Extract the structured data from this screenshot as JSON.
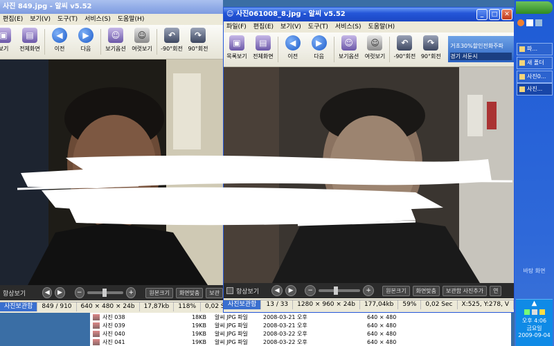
{
  "left_window": {
    "title": "사진 849.jpg - 알씨 v5.52",
    "menu": [
      "편집(E)",
      "보기(V)",
      "도구(T)",
      "서비스(S)",
      "도움말(H)"
    ],
    "tools": [
      "보기",
      "전체화면",
      "이전",
      "다음",
      "보기옵션",
      "여럿보기",
      "-90°회전",
      "90°회전"
    ],
    "bottom": {
      "always_view": "항상보기",
      "original_size": "원본크기",
      "fit_screen": "화면맞춤",
      "clip": "보관"
    },
    "status": {
      "tab": "사진보관함",
      "index": "849 / 910",
      "dims": "640 × 480 × 24b",
      "size": "17,87kb",
      "zoom": "118%",
      "time": "0,02 Sec"
    }
  },
  "right_window": {
    "title": "사진061008_8.jpg - 알씨 v5.52",
    "menu": [
      "파일(F)",
      "편집(E)",
      "보기(V)",
      "도구(T)",
      "서비스(S)",
      "도움말(H)"
    ],
    "tools": [
      "목록보기",
      "전체화면",
      "이전",
      "다음",
      "보기옵션",
      "여럿보기",
      "-90°회전",
      "90°회전"
    ],
    "ad_text": "거초30%할인전화주파",
    "ad_sub": "경기 서둔시",
    "bottom": {
      "always_view": "항상보기",
      "original_size": "원본크기",
      "fit_screen": "화면맞춤",
      "add_clip": "보관함 사진추가",
      "more": "연"
    },
    "status": {
      "tab": "사진보관함",
      "index": "13 / 33",
      "dims": "1280 × 960 × 24b",
      "size": "177,04kb",
      "zoom": "59%",
      "time": "0,02 Sec",
      "coords": "X:525, Y:278, V"
    }
  },
  "file_list": [
    {
      "name": "사진 038",
      "size": "18KB",
      "type": "알씨 JPG 파일",
      "date": "2008-03-21 오후",
      "dim": "640 × 480"
    },
    {
      "name": "사진 039",
      "size": "19KB",
      "type": "알씨 JPG 파일",
      "date": "2008-03-21 오후",
      "dim": "640 × 480"
    },
    {
      "name": "사진 040",
      "size": "19KB",
      "type": "알씨 JPG 파일",
      "date": "2008-03-22 오후",
      "dim": "640 × 480"
    },
    {
      "name": "사진 041",
      "size": "19KB",
      "type": "알씨 JPG 파일",
      "date": "2008-03-22 오후",
      "dim": "640 × 480"
    }
  ],
  "side_panel": {
    "items": [
      "파...",
      "새 폴더",
      "사진0...",
      "사진..."
    ],
    "desktop_label": "바탕 화면",
    "clock": "오후 4:06",
    "day": "금요일",
    "date": "2009-09-04"
  }
}
